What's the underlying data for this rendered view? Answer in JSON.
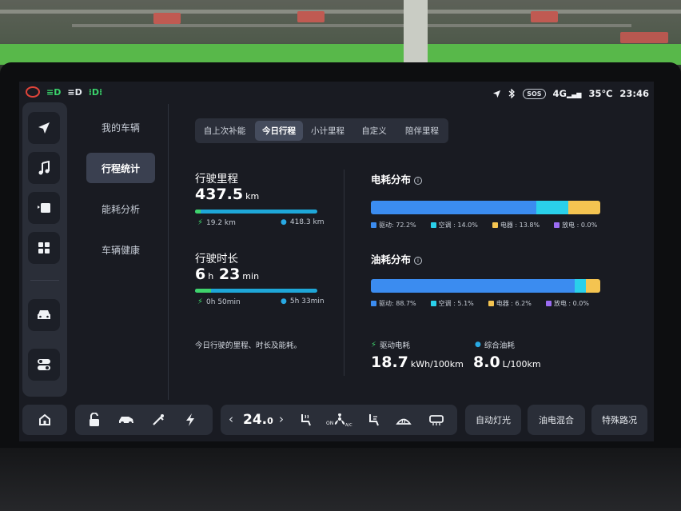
{
  "status": {
    "indicators_left": [
      "hazard-icon",
      "headlight-auto-icon",
      "headlight-icon",
      "parking-light-icon"
    ],
    "sos": "SOS",
    "network": "4G",
    "temperature": "35℃",
    "time": "23:46"
  },
  "menu": {
    "items": [
      {
        "label": "我的车辆",
        "active": false
      },
      {
        "label": "行程统计",
        "active": true
      },
      {
        "label": "能耗分析",
        "active": false
      },
      {
        "label": "车辆健康",
        "active": false
      }
    ]
  },
  "tabs": [
    {
      "label": "自上次补能",
      "active": false
    },
    {
      "label": "今日行程",
      "active": true
    },
    {
      "label": "小计里程",
      "active": false
    },
    {
      "label": "自定义",
      "active": false
    },
    {
      "label": "陪伴里程",
      "active": false
    }
  ],
  "distance": {
    "title": "行驶里程",
    "value": "437.5",
    "unit": "km",
    "electric": "19.2 km",
    "fuel": "418.3 km",
    "electric_fraction": 0.044
  },
  "duration": {
    "title": "行驶时长",
    "hours": "6",
    "h_unit": "h",
    "minutes": "23",
    "m_unit": "min",
    "electric": "0h 50min",
    "fuel": "5h 33min",
    "electric_fraction": 0.13
  },
  "note": "今日行驶的里程、时长及能耗。",
  "electric_distribution": {
    "title": "电耗分布",
    "segments": [
      {
        "label": "驱动: 72.2%",
        "value": 72.2,
        "color": "#3b8cf0"
      },
      {
        "label": "空调 : 14.0%",
        "value": 14.0,
        "color": "#2ad0ea"
      },
      {
        "label": "电器 : 13.8%",
        "value": 13.8,
        "color": "#f4c451"
      },
      {
        "label": "放电 : 0.0%",
        "value": 0.0,
        "color": "#9b6cf2"
      }
    ]
  },
  "fuel_distribution": {
    "title": "油耗分布",
    "segments": [
      {
        "label": "驱动: 88.7%",
        "value": 88.7,
        "color": "#3b8cf0"
      },
      {
        "label": "空调 : 5.1%",
        "value": 5.1,
        "color": "#2ad0ea"
      },
      {
        "label": "电器 : 6.2%",
        "value": 6.2,
        "color": "#f4c451"
      },
      {
        "label": "放电 : 0.0%",
        "value": 0.0,
        "color": "#9b6cf2"
      }
    ]
  },
  "consumption": {
    "electric_label": "驱动电耗",
    "electric_value": "18.7",
    "electric_unit": "kWh/100km",
    "fuel_label": "综合油耗",
    "fuel_value": "8.0",
    "fuel_unit": "L/100km"
  },
  "dock": {
    "temperature": "24.0",
    "temp_int": "24.",
    "temp_dec": "0",
    "buttons": [
      "自动灯光",
      "油电混合",
      "特殊路况"
    ]
  }
}
